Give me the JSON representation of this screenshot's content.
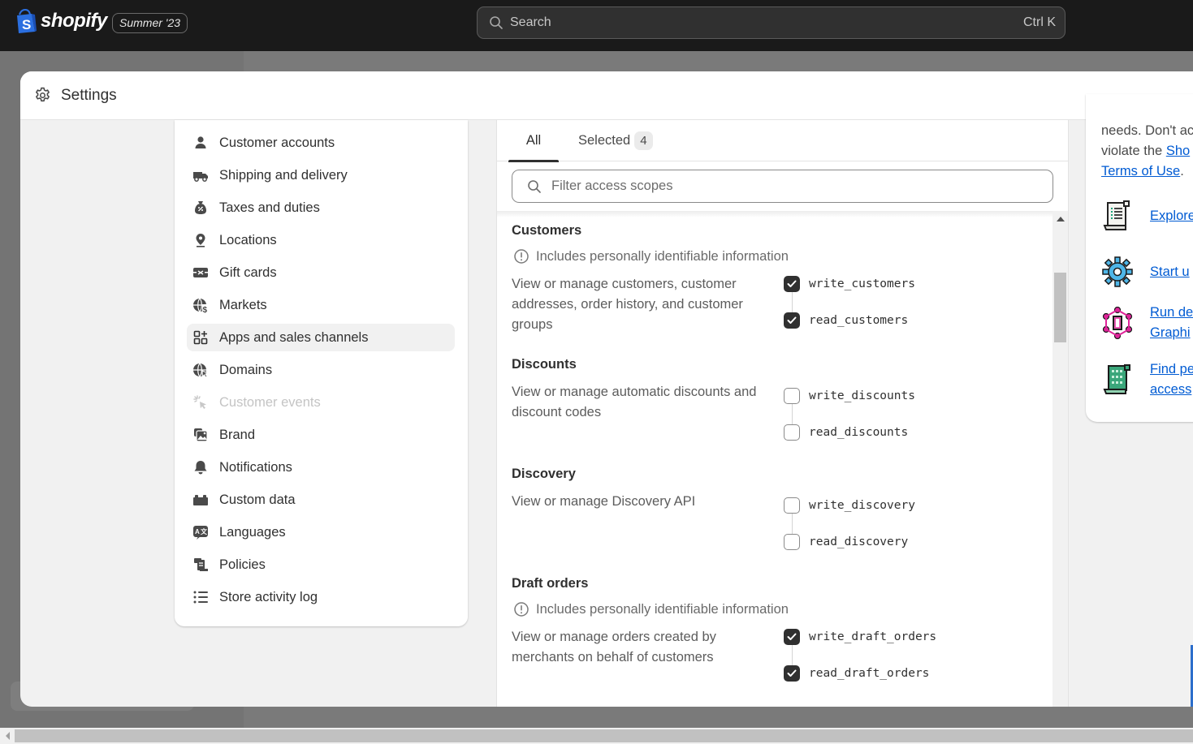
{
  "topbar": {
    "brand": "shopify",
    "edition": "Summer '23",
    "search_placeholder": "Search",
    "search_shortcut": "Ctrl K"
  },
  "modal": {
    "title": "Settings"
  },
  "nav": {
    "items": [
      {
        "label": "Customer accounts",
        "icon": "person-icon",
        "state": "normal"
      },
      {
        "label": "Shipping and delivery",
        "icon": "truck-icon",
        "state": "normal"
      },
      {
        "label": "Taxes and duties",
        "icon": "tax-bag-icon",
        "state": "normal"
      },
      {
        "label": "Locations",
        "icon": "location-pin-icon",
        "state": "normal"
      },
      {
        "label": "Gift cards",
        "icon": "gift-card-icon",
        "state": "normal"
      },
      {
        "label": "Markets",
        "icon": "globe-dollar-icon",
        "state": "normal"
      },
      {
        "label": "Apps and sales channels",
        "icon": "apps-icon",
        "state": "active"
      },
      {
        "label": "Domains",
        "icon": "globe-cursor-icon",
        "state": "normal"
      },
      {
        "label": "Customer events",
        "icon": "cursor-click-icon",
        "state": "disabled"
      },
      {
        "label": "Brand",
        "icon": "brand-image-icon",
        "state": "normal"
      },
      {
        "label": "Notifications",
        "icon": "bell-icon",
        "state": "normal"
      },
      {
        "label": "Custom data",
        "icon": "blocks-icon",
        "state": "normal"
      },
      {
        "label": "Languages",
        "icon": "translate-icon",
        "state": "normal"
      },
      {
        "label": "Policies",
        "icon": "policy-scroll-icon",
        "state": "normal"
      },
      {
        "label": "Store activity log",
        "icon": "list-icon",
        "state": "normal"
      }
    ]
  },
  "scopes": {
    "tabs": [
      {
        "label": "All",
        "selected": true
      },
      {
        "label": "Selected",
        "count": "4",
        "selected": false
      }
    ],
    "filter_placeholder": "Filter access scopes",
    "pii_notice": "Includes personally identifiable information",
    "groups": [
      {
        "title": "Customers",
        "pii": true,
        "description": "View or manage customers, customer addresses, order history, and customer groups",
        "scopes": [
          {
            "name": "write_customers",
            "checked": true
          },
          {
            "name": "read_customers",
            "checked": true
          }
        ]
      },
      {
        "title": "Discounts",
        "pii": false,
        "description": "View or manage automatic discounts and discount codes",
        "scopes": [
          {
            "name": "write_discounts",
            "checked": false
          },
          {
            "name": "read_discounts",
            "checked": false
          }
        ]
      },
      {
        "title": "Discovery",
        "pii": false,
        "description": "View or manage Discovery API",
        "scopes": [
          {
            "name": "write_discovery",
            "checked": false
          },
          {
            "name": "read_discovery",
            "checked": false
          }
        ]
      },
      {
        "title": "Draft orders",
        "pii": true,
        "description": "View or manage orders created by merchants on behalf of customers",
        "scopes": [
          {
            "name": "write_draft_orders",
            "checked": true
          },
          {
            "name": "read_draft_orders",
            "checked": true
          }
        ]
      }
    ]
  },
  "info_panel": {
    "line1": "needs. Don't ac",
    "line2_prefix": "violate the ",
    "line2_link": "Sho",
    "line3_link": "Terms of Use",
    "line3_suffix": ".",
    "links": [
      {
        "label": "Explore",
        "icon": "docs-scroll-icon"
      },
      {
        "label": "Start u",
        "icon": "blue-gear-icon"
      },
      {
        "label": "Run de",
        "label2": "Graphi",
        "icon": "graphql-icon"
      },
      {
        "label": "Find pe",
        "label2": "access",
        "icon": "green-scroll-icon"
      }
    ]
  }
}
